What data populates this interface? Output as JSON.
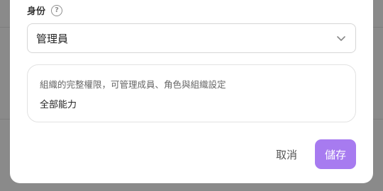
{
  "role_field": {
    "label": "身份",
    "help_icon": "question-circle-icon",
    "selected_value": "管理員",
    "dropdown_icon": "chevron-down-icon"
  },
  "role_info": {
    "description": "組織的完整權限，可管理成員、角色與組織設定",
    "permission": "全部能力"
  },
  "actions": {
    "cancel_label": "取消",
    "save_label": "儲存"
  },
  "colors": {
    "primary": "#a77bf0",
    "overlay": "#8a8a8a"
  }
}
